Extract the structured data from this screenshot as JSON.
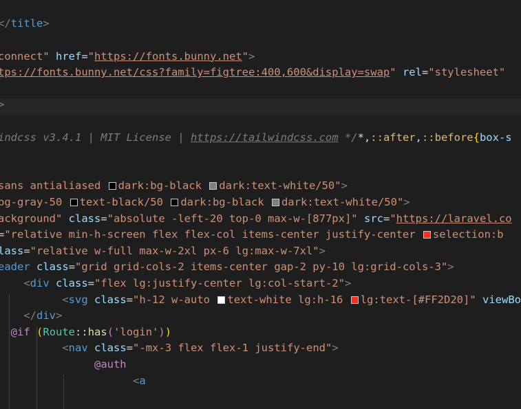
{
  "colors": {
    "background": "#1e1e1e",
    "highlight": "#262626",
    "tag": "#569cd6",
    "attribute": "#9cdcfe",
    "string": "#ce9178",
    "punctuation": "#808080",
    "comment": "#7c7c7c",
    "directive": "#c586c0",
    "swatch_black": "#000000",
    "swatch_white50": "#7f7f7f",
    "swatch_gray50": "#f9fafb",
    "swatch_white": "#ffffff",
    "swatch_red": "#ff2d20"
  },
  "lines": [
    {
      "segs": [
        [
          "p",
          "</"
        ],
        [
          "t",
          "title"
        ],
        [
          "p",
          ">"
        ]
      ]
    },
    {
      "segs": []
    },
    {
      "segs": [
        [
          "s",
          "connect\""
        ],
        [
          "tx",
          " "
        ],
        [
          "a",
          "href"
        ],
        [
          "o",
          "="
        ],
        [
          "s",
          "\""
        ],
        [
          "u",
          "https://fonts.bunny.net"
        ],
        [
          "s",
          "\""
        ],
        [
          "p",
          ">"
        ]
      ]
    },
    {
      "segs": [
        [
          "u",
          "tps://fonts.bunny.net/css?family=figtree:400,600&display=swap"
        ],
        [
          "s",
          "\""
        ],
        [
          "tx",
          " "
        ],
        [
          "a",
          "rel"
        ],
        [
          "o",
          "="
        ],
        [
          "s",
          "\"stylesheet\""
        ]
      ]
    },
    {
      "segs": []
    },
    {
      "segs": [
        [
          "p",
          ">"
        ]
      ]
    },
    {
      "segs": []
    },
    {
      "segs": [
        [
          "cm",
          "indcss v3.4.1 | MIT License | "
        ],
        [
          "cu",
          "https://tailwindcss.com"
        ],
        [
          "cm",
          " */"
        ],
        [
          "o",
          "*,"
        ],
        [
          "sel",
          "::after"
        ],
        [
          "o",
          ","
        ],
        [
          "sel",
          "::before"
        ],
        [
          "br",
          "{"
        ],
        [
          "a",
          "box-s"
        ]
      ]
    },
    {
      "segs": []
    },
    {
      "segs": []
    },
    {
      "segs": [
        [
          "s",
          "sans antialiased "
        ],
        [
          "sw",
          "swatch_black"
        ],
        [
          "s",
          "dark:bg-black "
        ],
        [
          "sw",
          "swatch_white50"
        ],
        [
          "s",
          "dark:text-white/50\""
        ],
        [
          "p",
          ">"
        ]
      ]
    },
    {
      "segs": [
        [
          "s",
          "bg-gray-50 "
        ],
        [
          "sw",
          "swatch_black"
        ],
        [
          "s",
          "text-black/50 "
        ],
        [
          "sw",
          "swatch_black"
        ],
        [
          "s",
          "dark:bg-black "
        ],
        [
          "sw",
          "swatch_white50"
        ],
        [
          "s",
          "dark:text-white/50\""
        ],
        [
          "p",
          ">"
        ]
      ]
    },
    {
      "segs": [
        [
          "s",
          "ackground\""
        ],
        [
          "tx",
          " "
        ],
        [
          "a",
          "class"
        ],
        [
          "o",
          "="
        ],
        [
          "s",
          "\"absolute -left-20 top-0 max-w-[877px]\""
        ],
        [
          "tx",
          " "
        ],
        [
          "a",
          "src"
        ],
        [
          "o",
          "="
        ],
        [
          "s",
          "\""
        ],
        [
          "u",
          "https://laravel.co"
        ]
      ]
    },
    {
      "segs": [
        [
          "o",
          "="
        ],
        [
          "s",
          "\"relative min-h-screen flex flex-col items-center justify-center "
        ],
        [
          "sw",
          "swatch_red"
        ],
        [
          "s",
          "selection:b"
        ]
      ]
    },
    {
      "segs": [
        [
          "a",
          "lass"
        ],
        [
          "o",
          "="
        ],
        [
          "s",
          "\"relative w-full max-w-2xl px-6 lg:max-w-7xl\""
        ],
        [
          "p",
          ">"
        ]
      ]
    },
    {
      "segs": [
        [
          "t",
          "eader"
        ],
        [
          "tx",
          " "
        ],
        [
          "a",
          "class"
        ],
        [
          "o",
          "="
        ],
        [
          "s",
          "\"grid grid-cols-2 items-center gap-2 py-10 lg:grid-cols-3\""
        ],
        [
          "p",
          ">"
        ]
      ]
    },
    {
      "indent": "    ",
      "segs": [
        [
          "p",
          "<"
        ],
        [
          "t",
          "div"
        ],
        [
          "tx",
          " "
        ],
        [
          "a",
          "class"
        ],
        [
          "o",
          "="
        ],
        [
          "s",
          "\"flex lg:justify-center lg:col-start-2\""
        ],
        [
          "p",
          ">"
        ]
      ]
    },
    {
      "indent": "          ",
      "segs": [
        [
          "p",
          "<"
        ],
        [
          "t",
          "svg"
        ],
        [
          "tx",
          " "
        ],
        [
          "a",
          "class"
        ],
        [
          "o",
          "="
        ],
        [
          "s",
          "\"h-12 w-auto "
        ],
        [
          "sw",
          "swatch_white"
        ],
        [
          "s",
          "text-white lg:h-16 "
        ],
        [
          "sw",
          "swatch_red"
        ],
        [
          "s",
          "lg:text-[#FF2D20]\""
        ],
        [
          "tx",
          " "
        ],
        [
          "a",
          "viewBox"
        ]
      ]
    },
    {
      "indent": "    ",
      "segs": [
        [
          "p",
          "</"
        ],
        [
          "t",
          "div"
        ],
        [
          "p",
          ">"
        ]
      ]
    },
    {
      "indent": "  ",
      "segs": [
        [
          "d",
          "@if"
        ],
        [
          "tx",
          " "
        ],
        [
          "br",
          "("
        ],
        [
          "cl",
          "Route"
        ],
        [
          "o",
          "::"
        ],
        [
          "f",
          "has"
        ],
        [
          "b2",
          "("
        ],
        [
          "s",
          "'login'"
        ],
        [
          "b2",
          ")"
        ],
        [
          "br",
          ")"
        ]
      ]
    },
    {
      "indent": "          ",
      "segs": [
        [
          "p",
          "<"
        ],
        [
          "t",
          "nav"
        ],
        [
          "tx",
          " "
        ],
        [
          "a",
          "class"
        ],
        [
          "o",
          "="
        ],
        [
          "s",
          "\"-mx-3 flex flex-1 justify-end\""
        ],
        [
          "p",
          ">"
        ]
      ]
    },
    {
      "indent": "               ",
      "segs": [
        [
          "d",
          "@auth"
        ]
      ]
    },
    {
      "indent": "                     ",
      "segs": [
        [
          "p",
          "<"
        ],
        [
          "t",
          "a"
        ]
      ]
    }
  ]
}
